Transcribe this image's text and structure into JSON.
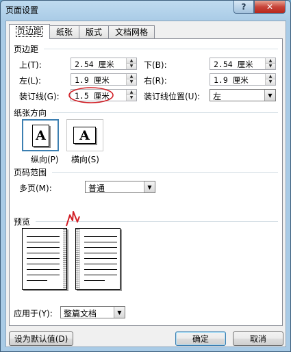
{
  "window": {
    "title": "页面设置",
    "help": "?",
    "close": "✕"
  },
  "tabs": [
    "页边距",
    "纸张",
    "版式",
    "文档网格"
  ],
  "margins": {
    "title": "页边距",
    "top_label": "上(T):",
    "top_value": "2.54 厘米",
    "bottom_label": "下(B):",
    "bottom_value": "2.54 厘米",
    "left_label": "左(L):",
    "left_value": "1.9 厘米",
    "right_label": "右(R):",
    "right_value": "1.9 厘米",
    "gutter_label": "装订线(G):",
    "gutter_value": "1.5 厘米",
    "gutter_pos_label": "装订线位置(U):",
    "gutter_pos_value": "左"
  },
  "orientation": {
    "title": "纸张方向",
    "portrait_label": "纵向(P)",
    "landscape_label": "横向(S)",
    "glyph": "A",
    "selected": "portrait"
  },
  "pages": {
    "title": "页码范围",
    "multiple_label": "多页(M):",
    "multiple_value": "普通"
  },
  "preview": {
    "title": "预览"
  },
  "apply": {
    "label": "应用于(Y):",
    "value": "整篇文档"
  },
  "buttons": {
    "set_default": "设为默认值(D)",
    "ok": "确定",
    "cancel": "取消"
  },
  "annotation_color": "#d21f26",
  "accent": "#3c7fb1"
}
